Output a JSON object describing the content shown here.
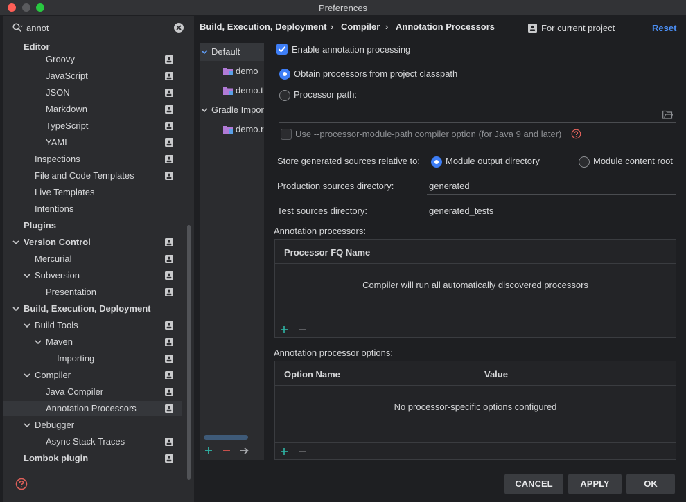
{
  "window": {
    "title": "Preferences"
  },
  "search": {
    "value": "annot"
  },
  "tree": [
    {
      "label": "Editor",
      "bold": true
    },
    {
      "label": "Groovy"
    },
    {
      "label": "JavaScript"
    },
    {
      "label": "JSON"
    },
    {
      "label": "Markdown"
    },
    {
      "label": "TypeScript"
    },
    {
      "label": "YAML"
    },
    {
      "label": "Inspections"
    },
    {
      "label": "File and Code Templates"
    },
    {
      "label": "Live Templates"
    },
    {
      "label": "Intentions"
    },
    {
      "label": "Plugins",
      "bold": true
    },
    {
      "label": "Version Control",
      "bold": true
    },
    {
      "label": "Mercurial"
    },
    {
      "label": "Subversion"
    },
    {
      "label": "Presentation"
    },
    {
      "label": "Build, Execution, Deployment",
      "bold": true
    },
    {
      "label": "Build Tools"
    },
    {
      "label": "Maven"
    },
    {
      "label": "Importing"
    },
    {
      "label": "Compiler"
    },
    {
      "label": "Java Compiler"
    },
    {
      "label": "Annotation Processors",
      "selected": true
    },
    {
      "label": "Debugger"
    },
    {
      "label": "Async Stack Traces"
    },
    {
      "label": "Lombok plugin",
      "bold": true
    }
  ],
  "profiles": [
    {
      "label": "Default",
      "selected": true
    },
    {
      "label": "demo"
    },
    {
      "label": "demo.t"
    },
    {
      "label": "Gradle Impor"
    },
    {
      "label": "demo.r"
    }
  ],
  "breadcrumb": {
    "part1": "Build, Execution, Deployment",
    "part2": "Compiler",
    "part3": "Annotation Processors"
  },
  "scope_label": "For current project",
  "reset_label": "Reset",
  "settings": {
    "enable_label": "Enable annotation processing",
    "enable_checked": true,
    "obtain_label": "Obtain processors from project classpath",
    "path_label": "Processor path:",
    "module_path_label": "Use --processor-module-path compiler option (for Java 9 and later)",
    "store_label": "Store generated sources relative to:",
    "module_output_label": "Module output directory",
    "module_content_label": "Module content root",
    "production_label": "Production sources directory:",
    "production_value": "generated",
    "test_label": "Test sources directory:",
    "test_value": "generated_tests"
  },
  "processors": {
    "section_label": "Annotation processors:",
    "column": "Processor FQ Name",
    "empty_text": "Compiler will run all automatically discovered processors"
  },
  "options": {
    "section_label": "Annotation processor options:",
    "col_name": "Option Name",
    "col_value": "Value",
    "empty_text": "No processor-specific options configured"
  },
  "buttons": {
    "cancel": "CANCEL",
    "apply": "APPLY",
    "ok": "OK"
  },
  "colors": {
    "accent": "#3e7ef6",
    "link": "#4b8ff6",
    "add": "#2fb5a6",
    "remove": "#d9534f"
  }
}
